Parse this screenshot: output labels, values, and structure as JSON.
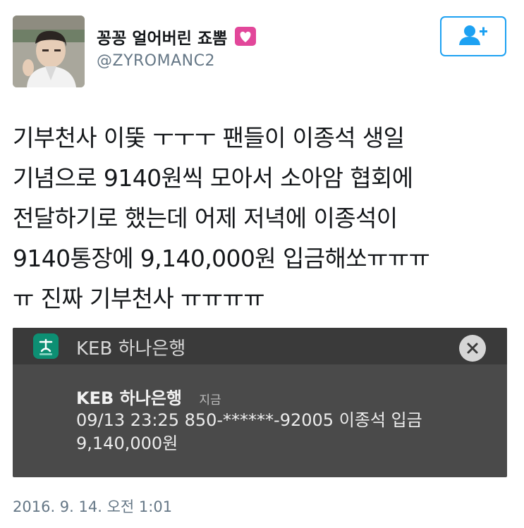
{
  "user": {
    "display_name": "꽁꽁 얼어버린 죠뽐",
    "handle": "@ZYROMANC2",
    "avatar": "profile-photo",
    "emoji": "sparkling-heart-icon"
  },
  "follow_button": {
    "icon": "add-user-icon",
    "color": "#1da1f2"
  },
  "tweet": {
    "lines": [
      "기부천사 이뚲 ㅜㅜㅜ 팬들이 이종석 생일",
      "기념으로 9140원씩 모아서 소아암 협회에",
      "전달하기로 했는데 어제 저녁에 이종석이",
      "9140통장에 9,140,000원 입금해쏘ㅠㅠㅠ",
      "ㅠ 진짜 기부천사 ㅠㅠㅠㅠ"
    ]
  },
  "notification": {
    "app_name": "KEB 하나은행",
    "app_icon": "hana-bank-icon",
    "close_icon": "close-icon",
    "title": "KEB 하나은행",
    "time": "지금",
    "body_line1": "09/13 23:25 850-******-92005 이종석 입금",
    "body_line2": "9,140,000원"
  },
  "timestamp": "2016. 9. 14. 오전 1:01"
}
